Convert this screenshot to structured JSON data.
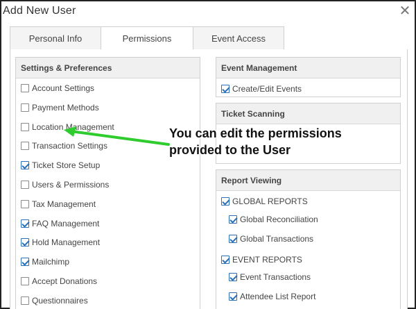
{
  "dialog": {
    "title": "Add New User",
    "close_icon": "close-icon"
  },
  "tabs": [
    {
      "label": "Personal Info",
      "active": false
    },
    {
      "label": "Permissions",
      "active": true
    },
    {
      "label": "Event Access",
      "active": false
    }
  ],
  "settings": {
    "heading": "Settings & Preferences",
    "items": [
      {
        "label": "Account Settings",
        "checked": false
      },
      {
        "label": "Payment Methods",
        "checked": false
      },
      {
        "label": "Location Management",
        "checked": false
      },
      {
        "label": "Transaction Settings",
        "checked": false
      },
      {
        "label": "Ticket Store Setup",
        "checked": true
      },
      {
        "label": "Users & Permissions",
        "checked": false
      },
      {
        "label": "Tax Management",
        "checked": false
      },
      {
        "label": "FAQ Management",
        "checked": true
      },
      {
        "label": "Hold Management",
        "checked": true
      },
      {
        "label": "Mailchimp",
        "checked": true
      },
      {
        "label": "Accept Donations",
        "checked": false
      },
      {
        "label": "Questionnaires",
        "checked": false
      }
    ]
  },
  "event_management": {
    "heading": "Event Management",
    "items": [
      {
        "label": "Create/Edit Events",
        "checked": true
      }
    ]
  },
  "ticket_scanning": {
    "heading": "Ticket Scanning"
  },
  "report_viewing": {
    "heading": "Report Viewing",
    "items": [
      {
        "label": "GLOBAL REPORTS",
        "checked": true
      },
      {
        "label": "Global Reconciliation",
        "checked": true
      },
      {
        "label": "Global Transactions",
        "checked": true
      },
      {
        "label": "EVENT REPORTS",
        "checked": true
      },
      {
        "label": "Event Transactions",
        "checked": true
      },
      {
        "label": "Attendee List Report",
        "checked": true
      }
    ]
  },
  "annotation": {
    "line1": "You can edit the permissions",
    "line2": "provided to the User",
    "arrow_color": "#2ecc2e"
  },
  "colors": {
    "accent": "#2a6fb6",
    "panel_header_bg": "#f0f0f0"
  }
}
